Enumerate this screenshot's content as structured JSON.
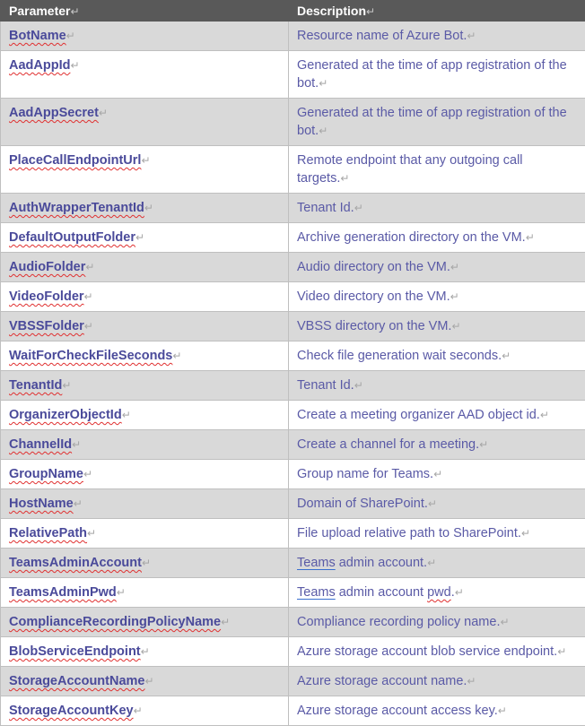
{
  "header": {
    "parameter": "Parameter",
    "description": "Description",
    "mark": "↵"
  },
  "rows": [
    {
      "param": "BotName",
      "desc": "Resource name of Azure Bot."
    },
    {
      "param": "AadAppId",
      "desc": "Generated at the time of app registration of the bot."
    },
    {
      "param": "AadAppSecret",
      "desc": "Generated at the time of app registration of the bot."
    },
    {
      "param": "PlaceCallEndpointUrl",
      "desc": "Remote endpoint that any outgoing call targets."
    },
    {
      "param": "AuthWrapperTenantId",
      "desc": "Tenant Id."
    },
    {
      "param": "DefaultOutputFolder",
      "desc": "Archive generation directory on the VM."
    },
    {
      "param": "AudioFolder",
      "desc": "Audio directory on the VM."
    },
    {
      "param": "VideoFolder",
      "desc": "Video directory on the VM."
    },
    {
      "param": "VBSSFolder",
      "desc": "VBSS directory on the VM."
    },
    {
      "param": "WaitForCheckFileSeconds",
      "desc": "Check file generation wait seconds."
    },
    {
      "param": "TenantId",
      "desc": "Tenant Id."
    },
    {
      "param": "OrganizerObjectId",
      "desc": "Create a meeting organizer AAD object id."
    },
    {
      "param": "ChannelId",
      "desc": "Create a channel for a meeting."
    },
    {
      "param": "GroupName",
      "desc": "Group name for Teams."
    },
    {
      "param": "HostName",
      "desc": "Domain of SharePoint."
    },
    {
      "param": "RelativePath",
      "desc": "File upload relative path to SharePoint."
    },
    {
      "param": "TeamsAdminAccount",
      "desc_lead": "Teams",
      "desc_rest": " admin account."
    },
    {
      "param": "TeamsAdminPwd",
      "desc_lead": "Teams",
      "desc_mid": " admin account ",
      "desc_sq": "pwd",
      "desc_tail": "."
    },
    {
      "param": "ComplianceRecordingPolicyName",
      "desc": "Compliance recording policy name."
    },
    {
      "param": "BlobServiceEndpoint",
      "desc": "Azure storage account blob service endpoint."
    },
    {
      "param": "StorageAccountName",
      "desc": "Azure storage account name."
    },
    {
      "param": "StorageAccountKey",
      "desc": "Azure storage account access key."
    }
  ]
}
